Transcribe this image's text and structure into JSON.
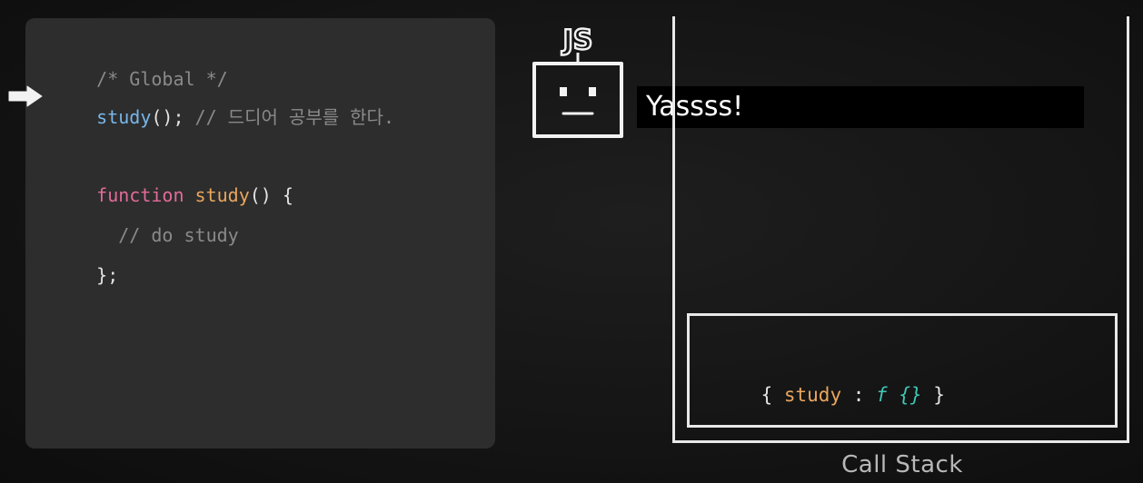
{
  "code": {
    "line1": "/* Global */",
    "line2": {
      "call": "study",
      "rest": "();",
      "comment": " // 드디어 공부를 한다."
    },
    "line3": {
      "keyword": "function",
      "name": "study",
      "rest": "() {"
    },
    "line4": "  // do study",
    "line5": "};"
  },
  "robot": {
    "label": "JS",
    "icon": "robot-icon"
  },
  "speech": {
    "text": "Yassss!"
  },
  "call_stack": {
    "caption": "Call Stack",
    "frame": {
      "open": "{ ",
      "key": "study",
      "sep": " : ",
      "value": "f {}",
      "close": " }"
    }
  },
  "pointer": {
    "icon": "arrow-right-icon"
  },
  "colors": {
    "comment": "#8a8a8a",
    "function_call": "#78b6ea",
    "keyword": "#e36b98",
    "function_name": "#e9a65e",
    "function_value": "#3fc7b5"
  }
}
